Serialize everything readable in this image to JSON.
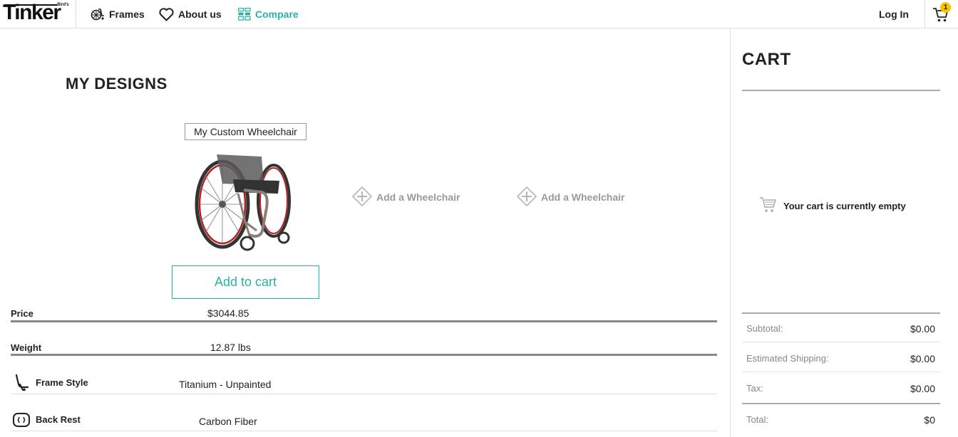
{
  "nav": {
    "logo": "Tinker",
    "logo_tag": "Bird's",
    "links": [
      {
        "label": "Frames",
        "icon": "wheelchair-icon"
      },
      {
        "label": "About us",
        "icon": "heart-icon"
      },
      {
        "label": "Compare",
        "icon": "compare-icon"
      }
    ],
    "login": "Log In",
    "cart_count": "1",
    "accent_color": "#2bb0a6"
  },
  "main": {
    "title": "MY DESIGNS",
    "design_name": "My Custom Wheelchair",
    "add_to_cart": "Add to cart",
    "add_slots": [
      "Add a Wheelchair",
      "Add a Wheelchair"
    ],
    "specs": [
      {
        "label": "Price",
        "value": "$3044.85"
      },
      {
        "label": "Weight",
        "value": "12.87 lbs"
      },
      {
        "label": "Frame Style",
        "value": "Titanium - Unpainted",
        "icon": "frame-style-icon"
      },
      {
        "label": "Back Rest",
        "value": "Carbon Fiber",
        "icon": "back-rest-icon"
      }
    ]
  },
  "cart": {
    "title": "CART",
    "empty_message": "Your cart is currently empty",
    "summary": [
      {
        "label": "Subtotal:",
        "value": "$0.00"
      },
      {
        "label": "Estimated Shipping:",
        "value": "$0.00"
      },
      {
        "label": "Tax:",
        "value": "$0.00"
      },
      {
        "label": "Total:",
        "value": "$0"
      }
    ]
  }
}
